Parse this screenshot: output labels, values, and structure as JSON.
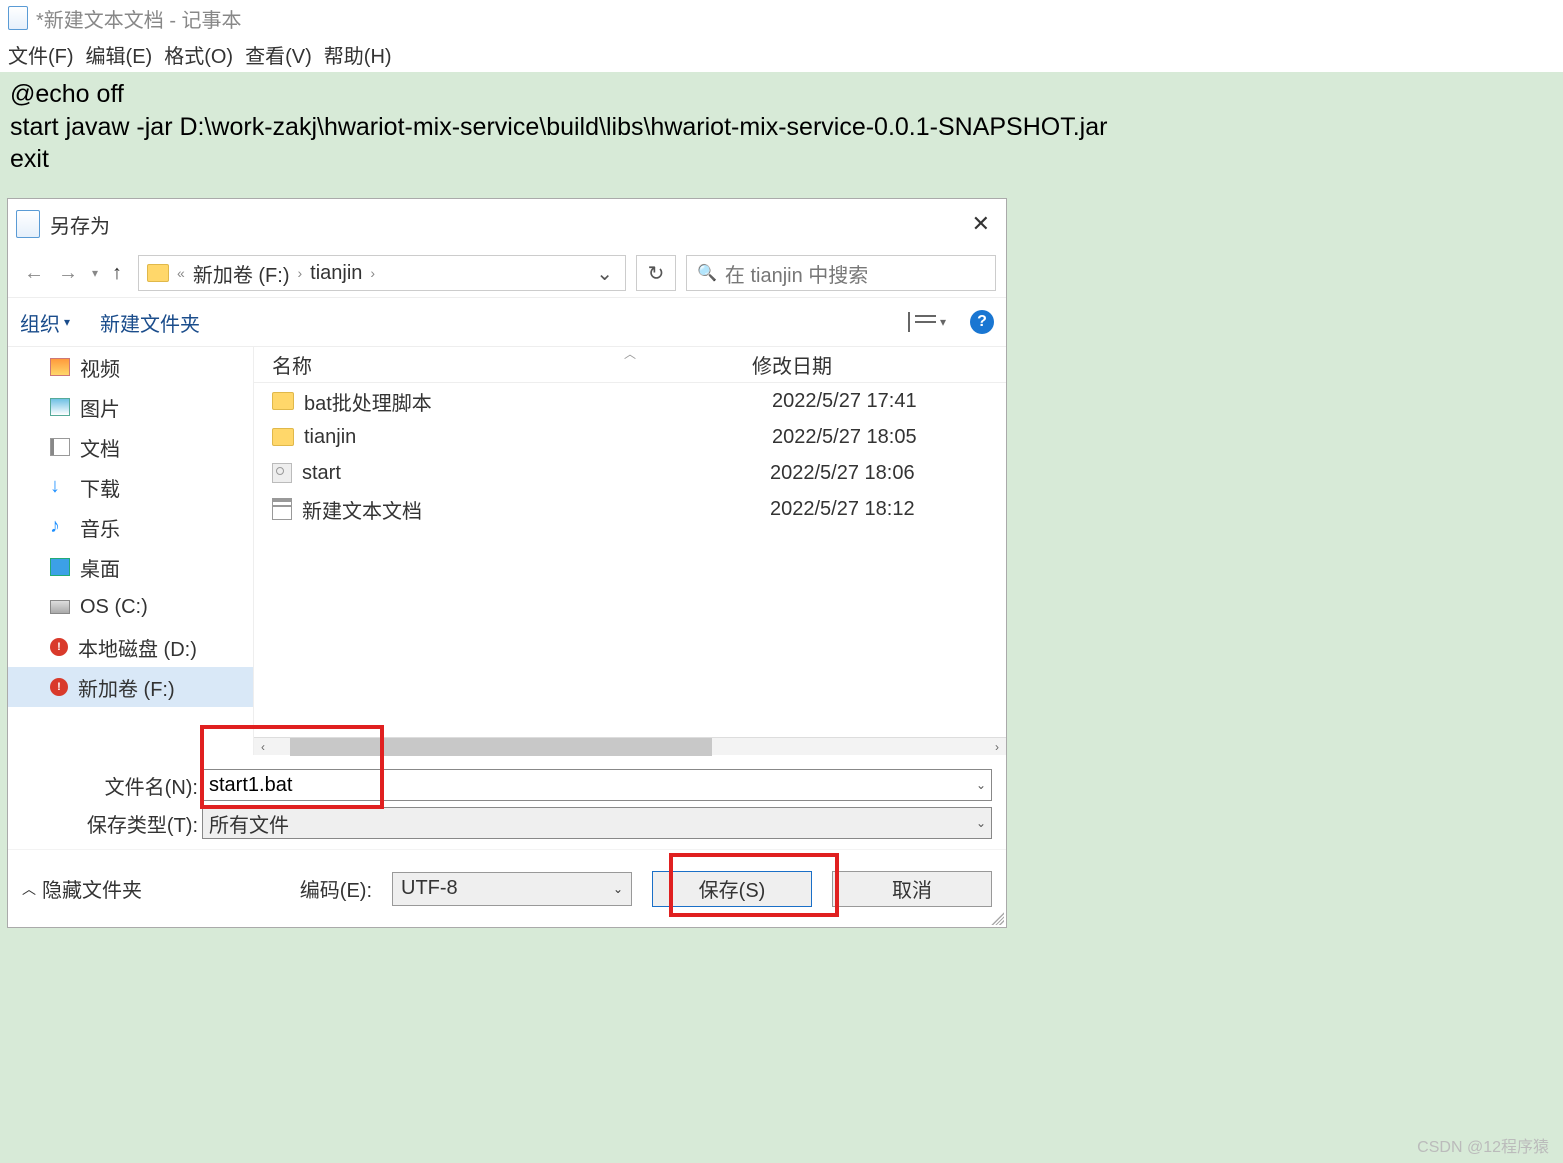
{
  "notepad": {
    "title": "*新建文本文档 - 记事本",
    "menu": {
      "file": "文件(F)",
      "edit": "编辑(E)",
      "format": "格式(O)",
      "view": "查看(V)",
      "help": "帮助(H)"
    },
    "lines": {
      "l1": "@echo off",
      "l2": "start javaw -jar D:\\work-zakj\\hwariot-mix-service\\build\\libs\\hwariot-mix-service-0.0.1-SNAPSHOT.jar",
      "l3": "exit"
    }
  },
  "dialog": {
    "title": "另存为",
    "nav": {
      "breadcrumb_prefix": "«",
      "bc1": "新加卷 (F:)",
      "bc2": "tianjin",
      "search_placeholder": "在 tianjin 中搜索"
    },
    "toolbar": {
      "organize": "组织",
      "newfolder": "新建文件夹"
    },
    "columns": {
      "name": "名称",
      "date": "修改日期"
    },
    "sidebar": {
      "video": "视频",
      "image": "图片",
      "doc": "文档",
      "download": "下载",
      "music": "音乐",
      "desktop": "桌面",
      "osc": "OS (C:)",
      "locald": "本地磁盘 (D:)",
      "volf": "新加卷 (F:)"
    },
    "files": [
      {
        "name": "bat批处理脚本",
        "date": "2022/5/27 17:41",
        "type": "folder"
      },
      {
        "name": "tianjin",
        "date": "2022/5/27 18:05",
        "type": "folder"
      },
      {
        "name": "start",
        "date": "2022/5/27 18:06",
        "type": "bat"
      },
      {
        "name": "新建文本文档",
        "date": "2022/5/27 18:12",
        "type": "txt"
      }
    ],
    "filename_label": "文件名(N):",
    "filename_value": "start1.bat",
    "filetype_label": "保存类型(T):",
    "filetype_value": "所有文件",
    "hide_folders": "隐藏文件夹",
    "encoding_label": "编码(E):",
    "encoding_value": "UTF-8",
    "save": "保存(S)",
    "cancel": "取消"
  },
  "watermark": "CSDN @12程序猿"
}
